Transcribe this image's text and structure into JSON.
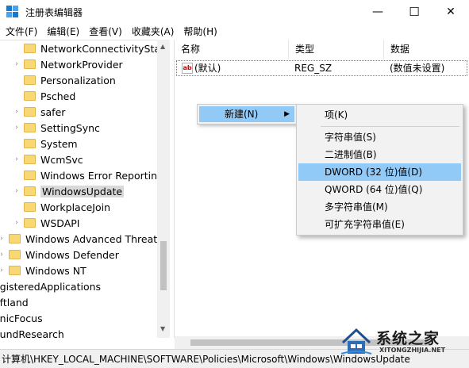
{
  "window": {
    "title": "注册表编辑器",
    "minimize": "—",
    "maximize": "☐",
    "close": "✕"
  },
  "menubar": [
    "文件(F)",
    "编辑(E)",
    "查看(V)",
    "收藏夹(A)",
    "帮助(H)"
  ],
  "tree": {
    "items": [
      {
        "label": "NetworkConnectivityStatu",
        "expandable": false,
        "selected": false
      },
      {
        "label": "NetworkProvider",
        "expandable": true,
        "selected": false
      },
      {
        "label": "Personalization",
        "expandable": false,
        "selected": false
      },
      {
        "label": "Psched",
        "expandable": false,
        "selected": false
      },
      {
        "label": "safer",
        "expandable": true,
        "selected": false
      },
      {
        "label": "SettingSync",
        "expandable": true,
        "selected": false
      },
      {
        "label": "System",
        "expandable": false,
        "selected": false
      },
      {
        "label": "WcmSvc",
        "expandable": true,
        "selected": false
      },
      {
        "label": "Windows Error Reporting",
        "expandable": false,
        "selected": false
      },
      {
        "label": "WindowsUpdate",
        "expandable": true,
        "selected": true
      },
      {
        "label": "WorkplaceJoin",
        "expandable": false,
        "selected": false
      },
      {
        "label": "WSDAPI",
        "expandable": true,
        "selected": false
      },
      {
        "label": "Windows Advanced Threat P",
        "expandable": true,
        "selected": false
      },
      {
        "label": "Windows Defender",
        "expandable": true,
        "selected": false
      },
      {
        "label": "Windows NT",
        "expandable": true,
        "selected": false
      },
      {
        "label": "egisteredApplications",
        "expandable": false,
        "selected": false
      },
      {
        "label": "oftland",
        "expandable": false,
        "selected": false
      },
      {
        "label": "onicFocus",
        "expandable": false,
        "selected": false
      },
      {
        "label": "oundResearch",
        "expandable": false,
        "selected": false
      }
    ]
  },
  "list": {
    "columns": [
      "名称",
      "类型",
      "数据"
    ],
    "rows": [
      {
        "icon": "ab",
        "name": "(默认)",
        "type": "REG_SZ",
        "data": "(数值未设置)"
      }
    ]
  },
  "context_menu": {
    "new_label": "新建(N)",
    "new_arrow": "▶",
    "submenu": [
      {
        "label": "项(K)",
        "highlighted": false
      },
      {
        "label": "字符串值(S)",
        "highlighted": false
      },
      {
        "label": "二进制值(B)",
        "highlighted": false
      },
      {
        "label": "DWORD (32 位)值(D)",
        "highlighted": true
      },
      {
        "label": "QWORD (64 位)值(Q)",
        "highlighted": false
      },
      {
        "label": "多字符串值(M)",
        "highlighted": false
      },
      {
        "label": "可扩充字符串值(E)",
        "highlighted": false
      }
    ]
  },
  "statusbar": {
    "path": "计算机\\HKEY_LOCAL_MACHINE\\SOFTWARE\\Policies\\Microsoft\\Windows\\WindowsUpdate"
  },
  "watermark": {
    "name": "系统之家",
    "url": "XITONGZHIJIA.NET"
  },
  "colors": {
    "highlight": "#91c9f7",
    "menu_bg": "#f2f2f2",
    "folder": "#f8d775",
    "selected_tree": "#d9d9d9"
  }
}
